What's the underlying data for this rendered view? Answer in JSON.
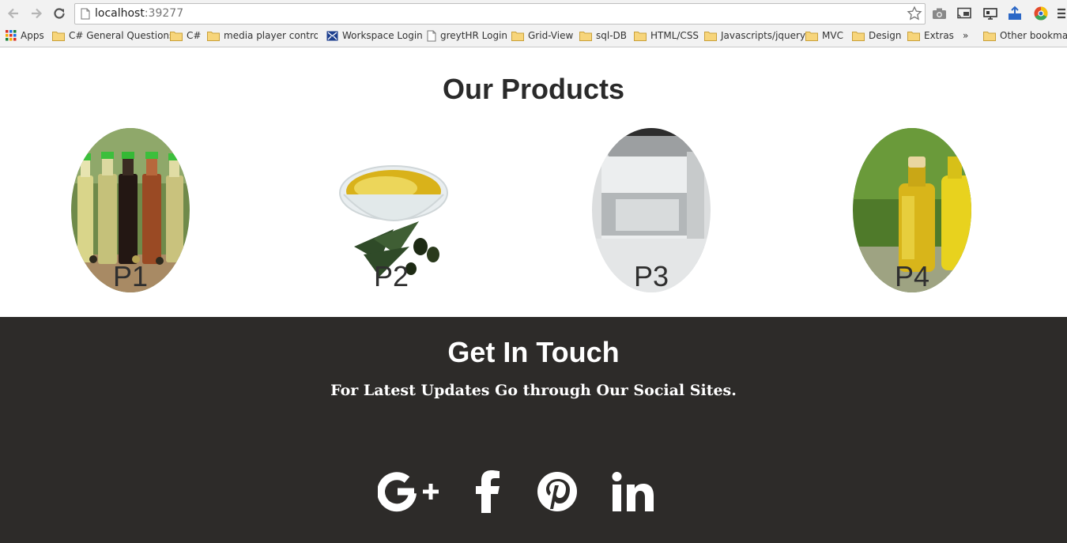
{
  "browser": {
    "url_host": "localhost",
    "url_port": ":39277",
    "bookmarks": [
      {
        "label": "Apps",
        "icon": "apps-grid-icon"
      },
      {
        "label": "C# General Questions",
        "icon": "folder-icon"
      },
      {
        "label": "C#",
        "icon": "folder-icon"
      },
      {
        "label": "media player control \\",
        "icon": "folder-icon"
      },
      {
        "label": "Workspace Login",
        "icon": "workspace-mail-icon"
      },
      {
        "label": "greytHR Login",
        "icon": "page-icon"
      },
      {
        "label": "Grid-View",
        "icon": "folder-icon"
      },
      {
        "label": "sql-DB",
        "icon": "folder-icon"
      },
      {
        "label": "HTML/CSS",
        "icon": "folder-icon"
      },
      {
        "label": "Javascripts/jquery",
        "icon": "folder-icon"
      },
      {
        "label": "MVC",
        "icon": "folder-icon"
      },
      {
        "label": "Design",
        "icon": "folder-icon"
      },
      {
        "label": "Extras",
        "icon": "folder-icon"
      }
    ],
    "overflow": "»",
    "other_bookmarks": "Other bookmarks"
  },
  "products": {
    "title": "Our Products",
    "items": [
      {
        "label": "P1",
        "image": "oil-bottles-image"
      },
      {
        "label": "P2",
        "image": "olive-oil-bowl-image"
      },
      {
        "label": "P3",
        "image": "clear-bottle-image"
      },
      {
        "label": "P4",
        "image": "yellow-oil-bottles-image"
      }
    ]
  },
  "contact": {
    "title": "Get In Touch",
    "subtitle": "For Latest Updates Go through Our Social Sites.",
    "social": [
      {
        "icon": "google-plus-icon"
      },
      {
        "icon": "facebook-icon"
      },
      {
        "icon": "pinterest-icon"
      },
      {
        "icon": "linkedin-icon"
      }
    ]
  },
  "colors": {
    "footer_bg": "#2d2b29",
    "heading": "#2a2a2a",
    "white": "#ffffff"
  }
}
